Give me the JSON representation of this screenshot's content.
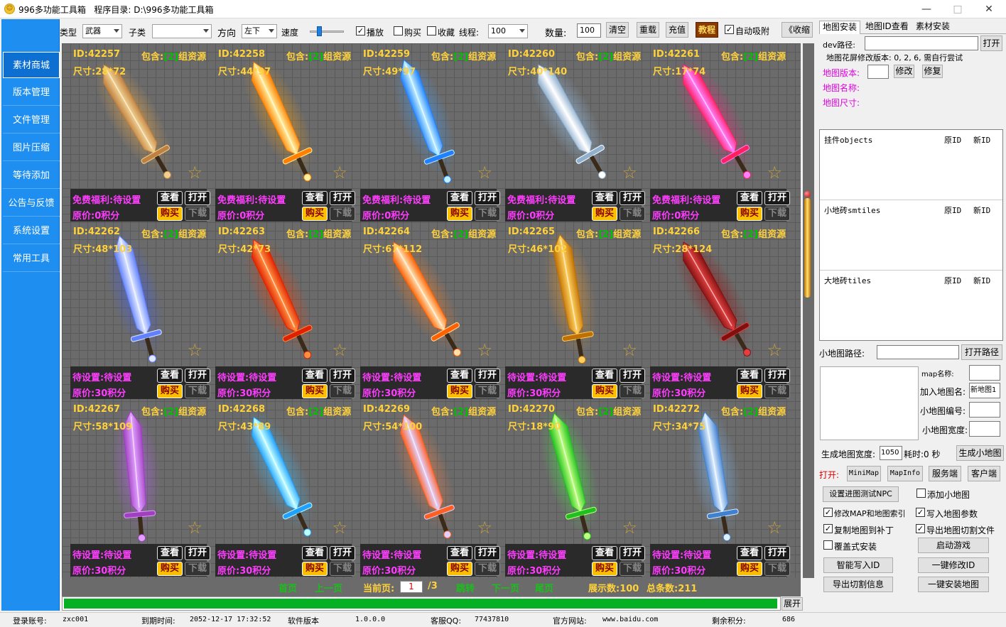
{
  "window": {
    "title": "996多功能工具箱",
    "dir_label": "程序目录:",
    "dir": "D:\\996多功能工具箱",
    "min": "—",
    "max": "□",
    "close": "✕"
  },
  "nav": [
    "素材商城",
    "版本管理",
    "文件管理",
    "图片压缩",
    "等待添加",
    "公告与反馈",
    "系统设置",
    "常用工具"
  ],
  "toolbar": {
    "type_label": "类型",
    "type_value": "武器",
    "subtype_label": "子类",
    "subtype_value": "",
    "dir_label": "方向",
    "dir_value": "左下",
    "speed_label": "速度",
    "play": "播放",
    "buy": "购买",
    "fav": "收藏",
    "thread_label": "线程:",
    "thread_value": "100",
    "count_label": "数量:",
    "count_value": "100",
    "clear": "清空",
    "reload": "重载",
    "recharge": "充值",
    "tutorial": "教程",
    "auto": "自动吸附",
    "collapse": "《收缩"
  },
  "cards": [
    {
      "id": "ID:42257",
      "size": "尺寸:28*72",
      "free": "免费福利:待设置",
      "price": "原价:0积分",
      "c1": "#c08040",
      "c2": "#f0d090",
      "glow": "#ffb040",
      "deg": -30
    },
    {
      "id": "ID:42258",
      "size": "尺寸:44*97",
      "free": "免费福利:待设置",
      "price": "原价:0积分",
      "c1": "#ff8000",
      "c2": "#fff0a0",
      "glow": "#ffa000",
      "deg": -25
    },
    {
      "id": "ID:42259",
      "size": "尺寸:49*97",
      "free": "免费福利:待设置",
      "price": "原价:0积分",
      "c1": "#2080ff",
      "c2": "#c0f0ff",
      "glow": "#40a0ff",
      "deg": -20
    },
    {
      "id": "ID:42260",
      "size": "尺寸:40*140",
      "free": "免费福利:待设置",
      "price": "原价:0积分",
      "c1": "#90b0d0",
      "c2": "#ffffff",
      "glow": "#a0d0ff",
      "deg": -30
    },
    {
      "id": "ID:42261",
      "size": "尺寸:17*74",
      "free": "免费福利:待设置",
      "price": "原价:0积分",
      "c1": "#ff2060",
      "c2": "#ff80ff",
      "glow": "#ff2080",
      "deg": -30
    },
    {
      "id": "ID:42262",
      "size": "尺寸:48*103",
      "free": "待设置:待设置",
      "price": "原价:30积分",
      "c1": "#6080ff",
      "c2": "#e0e8ff",
      "glow": "#4060ff",
      "deg": -15
    },
    {
      "id": "ID:42263",
      "size": "尺寸:42*73",
      "free": "待设置:待设置",
      "price": "原价:30积分",
      "c1": "#e02000",
      "c2": "#ff9040",
      "glow": "#ff4000",
      "deg": -25
    },
    {
      "id": "ID:42264",
      "size": "尺寸:67*112",
      "free": "待设置:待设置",
      "price": "原价:30积分",
      "c1": "#ff6000",
      "c2": "#ffe0b0",
      "glow": "#ff8020",
      "deg": -30
    },
    {
      "id": "ID:42265",
      "size": "尺寸:46*102",
      "free": "待设置:待设置",
      "price": "原价:30积分",
      "c1": "#c07000",
      "c2": "#ffd060",
      "glow": "#ffa020",
      "deg": -10
    },
    {
      "id": "ID:42266",
      "size": "尺寸:28*124",
      "free": "待设置:待设置",
      "price": "原价:30积分",
      "c1": "#801010",
      "c2": "#e04040",
      "glow": "#a00000",
      "deg": -30
    },
    {
      "id": "ID:42267",
      "size": "尺寸:58*109",
      "free": "待设置:待设置",
      "price": "原价:30积分",
      "c1": "#a040c0",
      "c2": "#e0a0ff",
      "glow": "#c060ff",
      "deg": -5
    },
    {
      "id": "ID:42268",
      "size": "尺寸:43*89",
      "free": "待设置:待设置",
      "price": "原价:30积分",
      "c1": "#20a0ff",
      "c2": "#c0ffff",
      "glow": "#40c0ff",
      "deg": -25
    },
    {
      "id": "ID:42269",
      "size": "尺寸:54*100",
      "free": "待设置:待设置",
      "price": "原价:30积分",
      "c1": "#ff6020",
      "c2": "#e0d0ff",
      "glow": "#ff8040",
      "deg": -20
    },
    {
      "id": "ID:42270",
      "size": "尺寸:18*90",
      "free": "待设置:待设置",
      "price": "原价:30积分",
      "c1": "#20c020",
      "c2": "#c0ff80",
      "glow": "#40ff40",
      "deg": -15
    },
    {
      "id": "ID:42272",
      "size": "尺寸:34*75",
      "free": "待设置:待设置",
      "price": "原价:30积分",
      "c1": "#4080d0",
      "c2": "#e0f0ff",
      "glow": "#80c0ff",
      "deg": -10
    }
  ],
  "card_labels": {
    "inc_pre": "包含:",
    "inc_num": "[2]",
    "inc_post": "组资源",
    "view": "查看",
    "open": "打开",
    "buy": "购买",
    "download": "下载"
  },
  "pager": {
    "first": "首页",
    "prev": "上一页",
    "current_label": "当前页:",
    "current": "1",
    "total": "/3",
    "jump": "跳转",
    "next": "下一页",
    "last": "尾页",
    "display": "展示数:100",
    "total_count": "总条数:211",
    "expand": "展开"
  },
  "right": {
    "tabs": [
      "地图安装",
      "地图ID查看",
      "素材安装"
    ],
    "dev_label": "dev路径:",
    "open": "打开",
    "note": "地图花屏修改版本: 0, 2, 6, 需自行尝试",
    "ver_label": "地图版本:",
    "modify": "修改",
    "repair": "修复",
    "name_label": "地图名称:",
    "size_label": "地图尺寸:",
    "objects": "挂件objects",
    "smtiles": "小地砖smtiles",
    "tiles": "大地砖tiles",
    "orig": "原ID",
    "new": "新ID",
    "minimap_label": "小地图路径:",
    "open_path": "打开路径",
    "map_name": "map名称:",
    "join_name": "加入地图名:",
    "join_value": "新地图1",
    "mini_no": "小地图编号:",
    "mini_w": "小地图宽度:",
    "gen_w_label": "生成地图宽度:",
    "gen_w": "1050",
    "elapsed": "耗时:0 秒",
    "gen_mini": "生成小地图",
    "open_label": "打开:",
    "minimap": "MiniMap",
    "mapinfo": "MapInfo",
    "server": "服务端",
    "client": "客户端",
    "set_npc": "设置进图测试NPC",
    "add_mini": "添加小地图",
    "mod_map": "修改MAP和地图索引",
    "write_param": "写入地图参数",
    "copy_map": "复制地图到补丁",
    "export_cut": "导出地图切割文件",
    "overwrite": "覆盖式安装",
    "start_game": "启动游戏",
    "smart_write": "智能写入ID",
    "one_mod": "一键修改ID",
    "export_info": "导出切割信息",
    "one_install": "一键安装地图"
  },
  "status": {
    "account_label": "登录账号:",
    "account": "zxc001",
    "expire_label": "到期时间:",
    "expire": "2052-12-17 17:32:52",
    "ver_label": "软件版本",
    "ver": "1.0.0.0",
    "qq_label": "客服QQ:",
    "qq": "77437810",
    "site_label": "官方网站:",
    "site": "www.baidu.com",
    "points_label": "剩余积分:",
    "points": "686"
  }
}
